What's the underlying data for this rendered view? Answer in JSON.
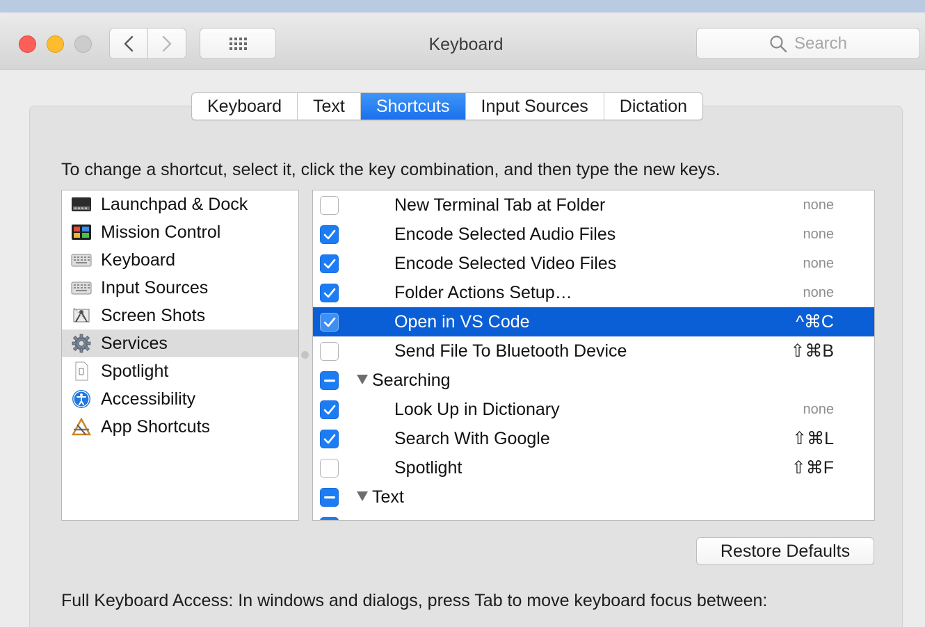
{
  "window": {
    "title": "Keyboard"
  },
  "toolbar": {
    "search_placeholder": "Search"
  },
  "tabs": [
    {
      "label": "Keyboard",
      "active": false
    },
    {
      "label": "Text",
      "active": false
    },
    {
      "label": "Shortcuts",
      "active": true
    },
    {
      "label": "Input Sources",
      "active": false
    },
    {
      "label": "Dictation",
      "active": false
    }
  ],
  "instruction": "To change a shortcut, select it, click the key combination, and then type the new keys.",
  "categories": [
    {
      "label": "Launchpad & Dock",
      "icon": "launchpad-icon"
    },
    {
      "label": "Mission Control",
      "icon": "mission-control-icon"
    },
    {
      "label": "Keyboard",
      "icon": "keyboard-icon"
    },
    {
      "label": "Input Sources",
      "icon": "input-sources-icon"
    },
    {
      "label": "Screen Shots",
      "icon": "screenshot-icon"
    },
    {
      "label": "Services",
      "icon": "gear-icon",
      "selected": true
    },
    {
      "label": "Spotlight",
      "icon": "spotlight-icon"
    },
    {
      "label": "Accessibility",
      "icon": "accessibility-icon"
    },
    {
      "label": "App Shortcuts",
      "icon": "app-shortcuts-icon"
    }
  ],
  "services": [
    {
      "type": "item",
      "label": "New Terminal Tab at Folder",
      "state": "unchecked",
      "shortcut": "none"
    },
    {
      "type": "item",
      "label": "Encode Selected Audio Files",
      "state": "checked",
      "shortcut": "none"
    },
    {
      "type": "item",
      "label": "Encode Selected Video Files",
      "state": "checked",
      "shortcut": "none"
    },
    {
      "type": "item",
      "label": "Folder Actions Setup…",
      "state": "checked",
      "shortcut": "none"
    },
    {
      "type": "item",
      "label": "Open in VS Code",
      "state": "checked",
      "shortcut": "^⌘C",
      "selected": true
    },
    {
      "type": "item",
      "label": "Send File To Bluetooth Device",
      "state": "unchecked",
      "shortcut": "⇧⌘B"
    },
    {
      "type": "group",
      "label": "Searching",
      "state": "mixed"
    },
    {
      "type": "item",
      "label": "Look Up in Dictionary",
      "state": "checked",
      "shortcut": "none"
    },
    {
      "type": "item",
      "label": "Search With Google",
      "state": "checked",
      "shortcut": "⇧⌘L"
    },
    {
      "type": "item",
      "label": "Spotlight",
      "state": "unchecked",
      "shortcut": "⇧⌘F"
    },
    {
      "type": "group",
      "label": "Text",
      "state": "mixed"
    },
    {
      "type": "item",
      "label": "",
      "state": "checked",
      "shortcut": ""
    }
  ],
  "restore_label": "Restore Defaults",
  "full_keyboard_access": "Full Keyboard Access: In windows and dialogs, press Tab to move keyboard focus between:",
  "colors": {
    "accent": "#1c7cf3",
    "selection": "#0a5fd6"
  }
}
